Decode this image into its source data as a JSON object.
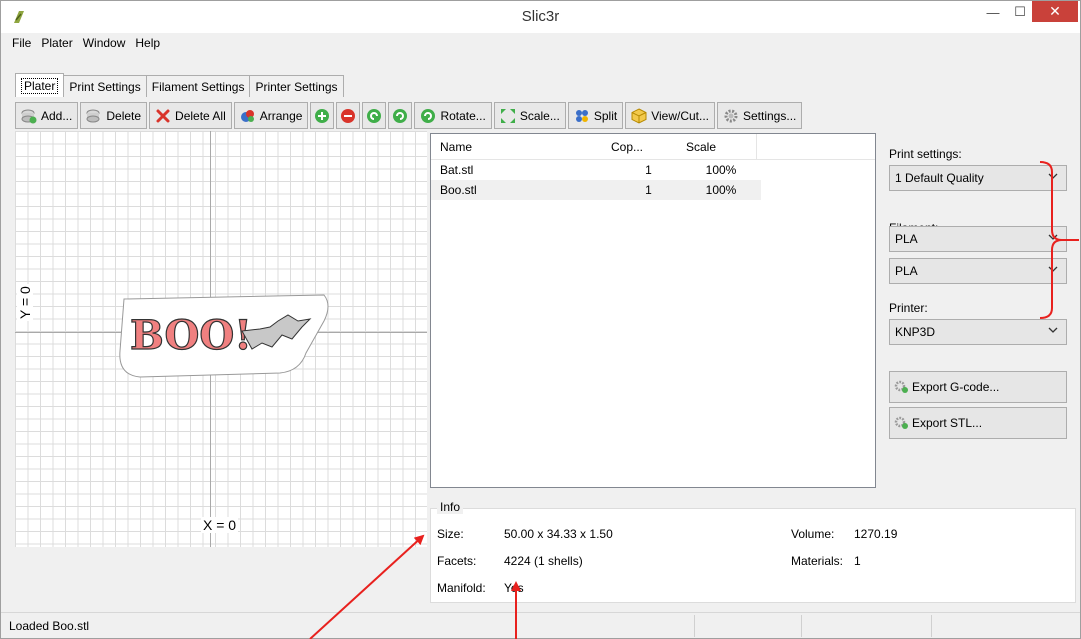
{
  "window": {
    "title": "Slic3r",
    "minimize_glyph": "—",
    "maximize_glyph": "☐",
    "close_glyph": "✕"
  },
  "menu": [
    "File",
    "Plater",
    "Window",
    "Help"
  ],
  "tabs": [
    "Plater",
    "Print Settings",
    "Filament Settings",
    "Printer Settings"
  ],
  "toolbar": {
    "add": "Add...",
    "delete": "Delete",
    "delete_all": "Delete All",
    "arrange": "Arrange",
    "rotate": "Rotate...",
    "scale": "Scale...",
    "split": "Split",
    "view_cut": "View/Cut...",
    "settings": "Settings..."
  },
  "plater": {
    "x_label": "X = 0",
    "y_label": "Y = 0",
    "object_text": "BOO!"
  },
  "objects": {
    "columns": [
      "Name",
      "Cop...",
      "Scale"
    ],
    "rows": [
      {
        "name": "Bat.stl",
        "copies": "1",
        "scale": "100%"
      },
      {
        "name": "Boo.stl",
        "copies": "1",
        "scale": "100%"
      }
    ]
  },
  "settings_panel": {
    "print_label": "Print settings:",
    "print_value": "1 Default Quality",
    "filament_label": "Filament:",
    "filament_1": "PLA",
    "filament_2": "PLA",
    "printer_label": "Printer:",
    "printer_value": "KNP3D",
    "export_gcode": "Export G-code...",
    "export_stl": "Export STL..."
  },
  "info": {
    "legend": "Info",
    "size_label": "Size:",
    "size_value": "50.00 x 34.33 x 1.50",
    "facets_label": "Facets:",
    "facets_value": "4224 (1 shells)",
    "manifold_label": "Manifold:",
    "manifold_value": "Yes",
    "volume_label": "Volume:",
    "volume_value": "1270.19",
    "materials_label": "Materials:",
    "materials_value": "1"
  },
  "status": {
    "text": "Loaded Boo.stl"
  },
  "colors": {
    "close_button": "#c9413a",
    "annotation_red": "#e8211e",
    "boo_fill": "#f08080",
    "bat_fill": "#c8c8c8"
  }
}
